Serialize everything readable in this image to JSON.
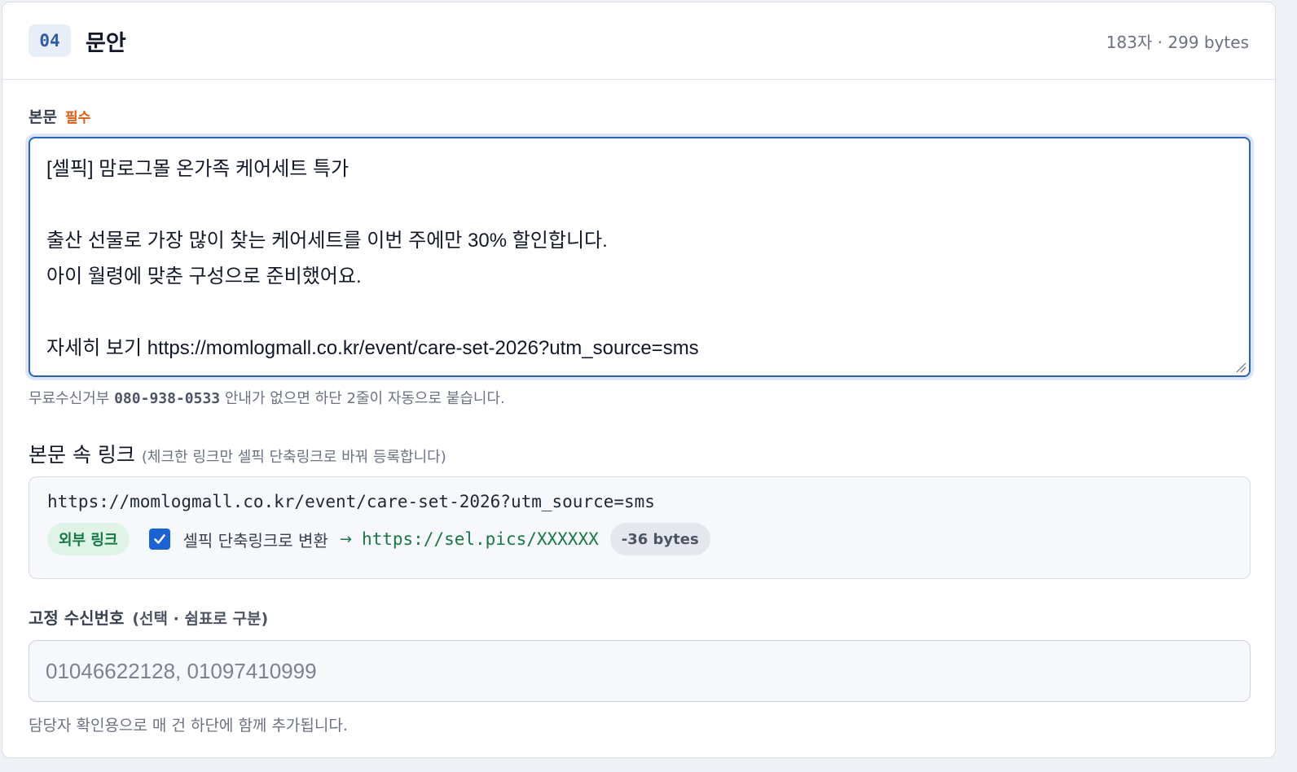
{
  "header": {
    "step": "04",
    "title": "문안",
    "counter": "183자 · 299 bytes"
  },
  "body_field": {
    "label": "본문",
    "required": "필수",
    "value": "[셀픽] 맘로그몰 온가족 케어세트 특가\n\n출산 선물로 가장 많이 찾는 케어세트를 이번 주에만 30% 할인합니다.\n아이 월령에 맞춘 구성으로 준비했어요.\n\n자세히 보기 https://momlogmall.co.kr/event/care-set-2026?utm_source=sms",
    "help_prefix": "무료수신거부",
    "help_number": "080-938-0533",
    "help_suffix": "안내가 없으면 하단 2줄이 자동으로 붙습니다."
  },
  "links": {
    "label": "본문 속 링크",
    "hint": "(체크한 링크만 셀픽 단축링크로 바꿔 등록합니다)",
    "items": [
      {
        "url": "https://momlogmall.co.kr/event/care-set-2026?utm_source=sms",
        "badge": "외부 링크",
        "checked": true,
        "convert_label": "셀픽 단축링크로 변환",
        "arrow": "→",
        "short_url": "https://sel.pics/XXXXXX",
        "bytes_delta": "-36 bytes"
      }
    ]
  },
  "fixed_recipients": {
    "label": "고정 수신번호",
    "hint": "(선택 · 쉼표로 구분)",
    "placeholder": "01046622128, 01097410999",
    "help": "담당자 확인용으로 매 건 하단에 함께 추가됩니다."
  },
  "colors": {
    "accent": "#2563c9",
    "required": "#ea580c",
    "link_green": "#137a43",
    "checkbox": "#1a62d6"
  }
}
